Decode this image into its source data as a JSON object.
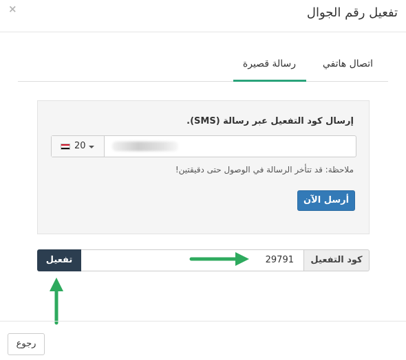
{
  "modal": {
    "title": "تفعيل رقم الجوال",
    "close_icon": "close-icon"
  },
  "tabs": [
    {
      "label": "اتصال هاتفي",
      "active": false
    },
    {
      "label": "رسالة قصيرة",
      "active": true
    }
  ],
  "sms_panel": {
    "heading": "إرسال كود التفعيل عبر رسالة (SMS).",
    "country_flag": "egypt-flag-icon",
    "country_code": "20",
    "phone_value": "",
    "note": "ملاحظة: قد تتأخر الرسالة في الوصول حتى دقيقتين!",
    "send_label": "أرسل الآن"
  },
  "activation": {
    "addon_label": "كود التفعيل",
    "code_value": "29791",
    "activate_label": "تفعيل"
  },
  "footer": {
    "back_label": "رجوع"
  },
  "colors": {
    "tab_accent": "#2aa37a",
    "primary_button": "#337ab7",
    "activate_button": "#2c3e50",
    "annotation_arrow": "#2eaa5e"
  }
}
